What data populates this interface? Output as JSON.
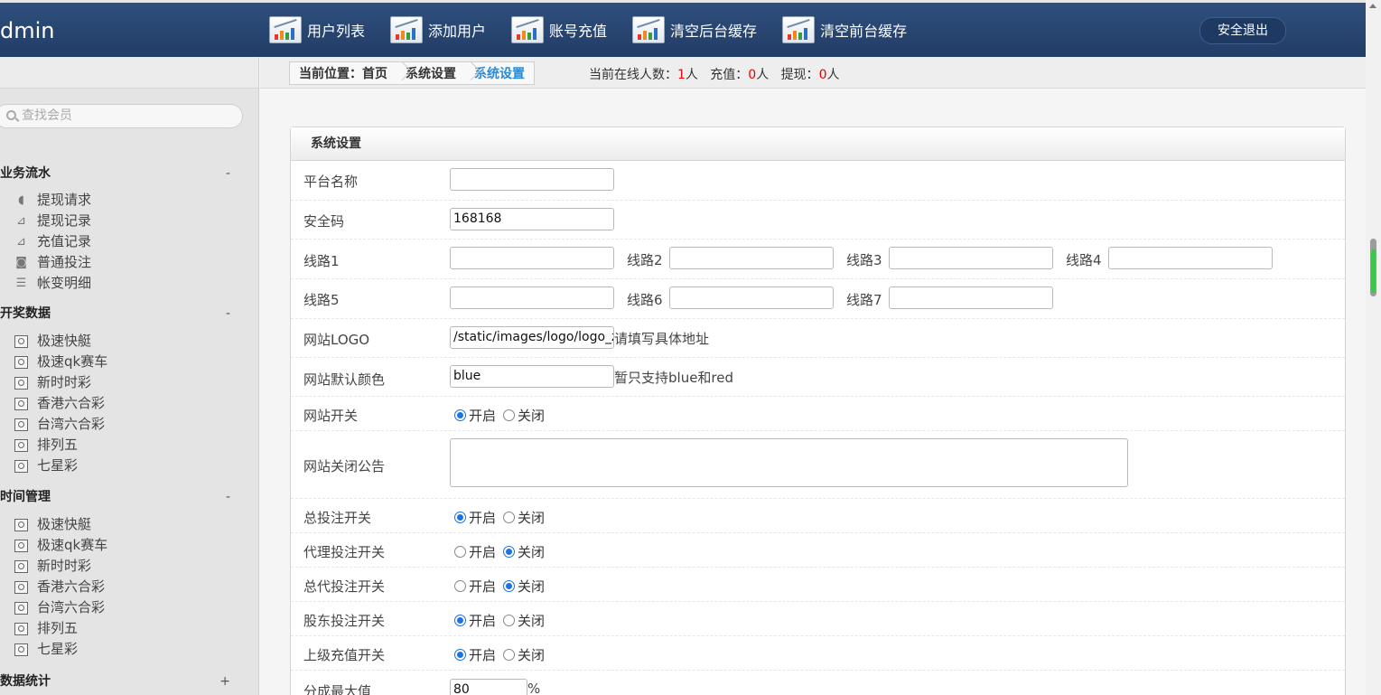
{
  "brand": "dmin",
  "topnav": [
    {
      "label": "用户列表"
    },
    {
      "label": "添加用户"
    },
    {
      "label": "账号充值"
    },
    {
      "label": "清空后台缓存"
    },
    {
      "label": "清空前台缓存"
    }
  ],
  "logout_label": "安全退出",
  "breadcrumb": {
    "prefix": "当前位置：首页",
    "level2": "系统设置",
    "current": "系统设置"
  },
  "online": {
    "label_online": "当前在线人数：",
    "online_count": "1",
    "unit1": "人",
    "label_recharge": "充值：",
    "recharge_count": "0",
    "unit2": "人",
    "label_withdraw": "提现：",
    "withdraw_count": "0",
    "unit3": "人"
  },
  "search_placeholder": "查找会员",
  "sidebar": {
    "groups": [
      {
        "title": "业务流水",
        "toggle": "-",
        "items": [
          {
            "label": "提现请求",
            "icon": "speaker-icon"
          },
          {
            "label": "提现记录",
            "icon": "chart-icon"
          },
          {
            "label": "充值记录",
            "icon": "chart-icon"
          },
          {
            "label": "普通投注",
            "icon": "shield-icon"
          },
          {
            "label": "帐变明细",
            "icon": "list-icon"
          }
        ]
      },
      {
        "title": "开奖数据",
        "toggle": "-",
        "items": [
          {
            "label": "极速快艇"
          },
          {
            "label": "极速qk赛车"
          },
          {
            "label": "新时时彩"
          },
          {
            "label": "香港六合彩"
          },
          {
            "label": "台湾六合彩"
          },
          {
            "label": "排列五"
          },
          {
            "label": "七星彩"
          }
        ]
      },
      {
        "title": "时间管理",
        "toggle": "-",
        "items": [
          {
            "label": "极速快艇"
          },
          {
            "label": "极速qk赛车"
          },
          {
            "label": "新时时彩"
          },
          {
            "label": "香港六合彩"
          },
          {
            "label": "台湾六合彩"
          },
          {
            "label": "排列五"
          },
          {
            "label": "七星彩"
          }
        ]
      },
      {
        "title": "数据统计",
        "toggle": "+",
        "items": []
      }
    ]
  },
  "panel_title": "系统设置",
  "form": {
    "platform_name_label": "平台名称",
    "platform_name_value": "",
    "security_code_label": "安全码",
    "security_code_value": "168168",
    "route1_label": "线路1",
    "route2_label": "线路2",
    "route3_label": "线路3",
    "route4_label": "线路4",
    "route5_label": "线路5",
    "route6_label": "线路6",
    "route7_label": "线路7",
    "route1_value": "",
    "route2_value": "",
    "route3_value": "",
    "route4_value": "",
    "route5_value": "",
    "route6_value": "",
    "route7_value": "",
    "logo_label": "网站LOGO",
    "logo_value": "/static/images/logo/logo_zc.png",
    "logo_hint": "请填写具体地址",
    "color_label": "网站默认颜色",
    "color_value": "blue",
    "color_hint": "暂只支持blue和red",
    "site_switch_label": "网站开关",
    "site_close_notice_label": "网站关闭公告",
    "total_bet_label": "总投注开关",
    "agent_bet_label": "代理投注开关",
    "general_agent_bet_label": "总代投注开关",
    "shareholder_bet_label": "股东投注开关",
    "parent_recharge_label": "上级充值开关",
    "max_share_label": "分成最大值",
    "max_share_value": "80",
    "max_share_unit": "%",
    "opt_on": "开启",
    "opt_off": "关闭"
  },
  "colors": {
    "header_bg": "#2a4772",
    "accent": "#2a8ad4",
    "highlight_red": "#e00000",
    "sidebar_bg": "#e4e4e4"
  }
}
